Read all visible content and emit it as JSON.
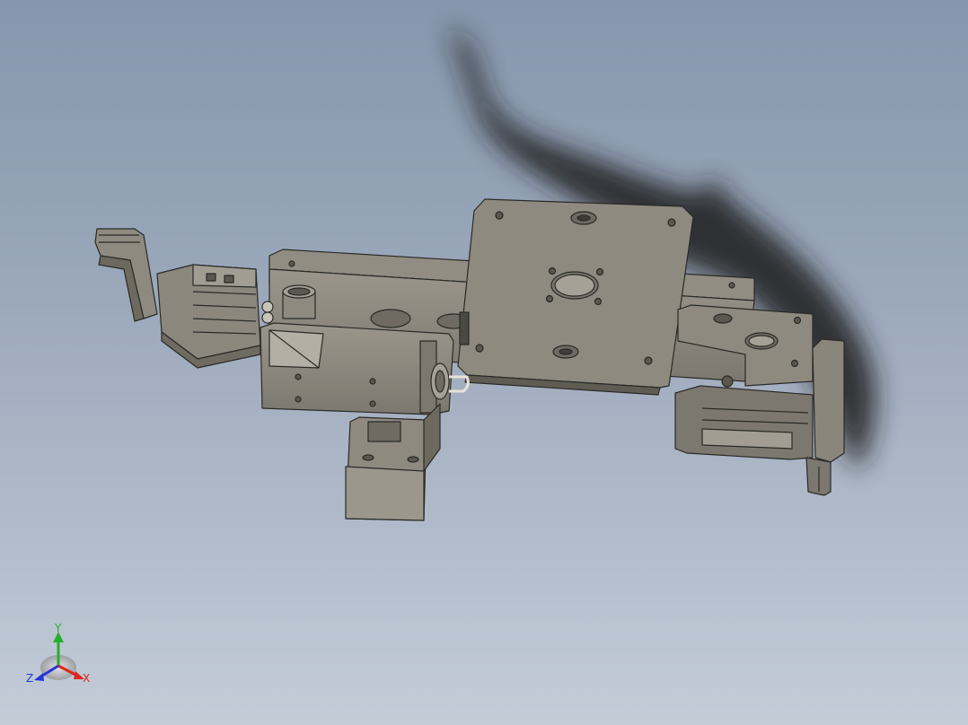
{
  "viewport": {
    "triad": {
      "x_label": "X",
      "y_label": "Y",
      "z_label": "Z",
      "x_color": "#e0261b",
      "y_color": "#22b02a",
      "z_color": "#2436d8"
    },
    "model_color": "#8c887e",
    "edge_color": "#2a2a26"
  }
}
